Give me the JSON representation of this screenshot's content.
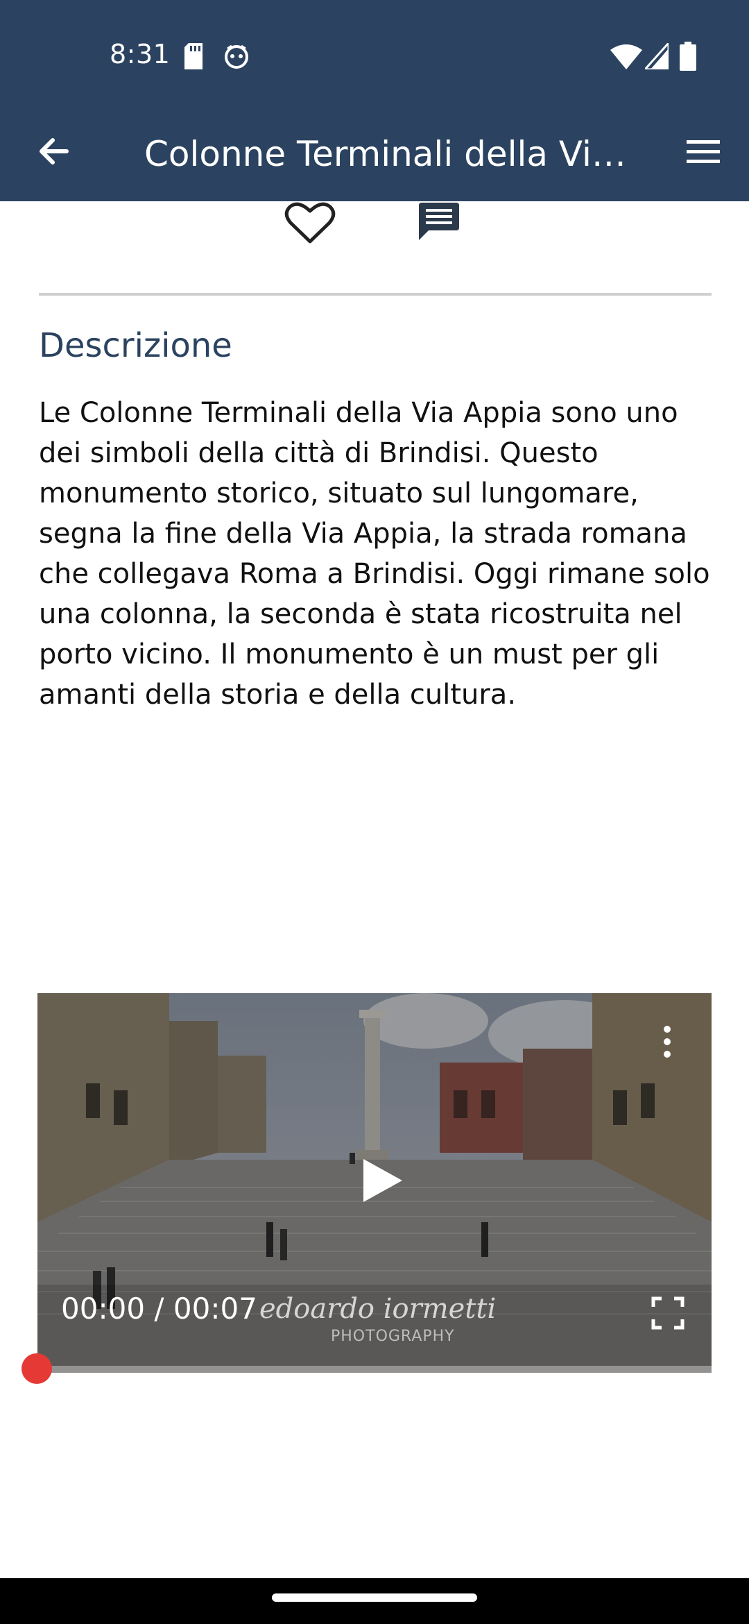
{
  "status_bar": {
    "time": "8:31",
    "icons": [
      "sd-card-icon",
      "face-icon",
      "wifi-icon",
      "signal-icon",
      "battery-icon"
    ]
  },
  "app_bar": {
    "title": "Colonne Terminali della Via Appia",
    "back_icon": "arrow-back-icon",
    "menu_icon": "hamburger-menu-icon"
  },
  "actions": {
    "favorite_icon": "heart-outline-icon",
    "comment_icon": "comment-icon"
  },
  "description": {
    "title": "Descrizione",
    "text": "Le Colonne Terminali della Via Appia sono uno dei simboli della città di Brindisi. Questo monumento storico, situato sul lungomare, segna la fine della Via Appia, la strada romana che collegava Roma a Brindisi. Oggi rimane solo una colonna, la seconda è stata ricostruita nel porto vicino. Il monumento è un must per gli amanti della storia e della cultura."
  },
  "video": {
    "time_display": "00:00 / 00:07",
    "progress": 0,
    "watermark": "edoardo iormetti",
    "watermark_sub": "PHOTOGRAPHY",
    "accent_color": "#e53935"
  },
  "colors": {
    "app_bar": "#2b4360",
    "section_title": "#2b4360"
  }
}
